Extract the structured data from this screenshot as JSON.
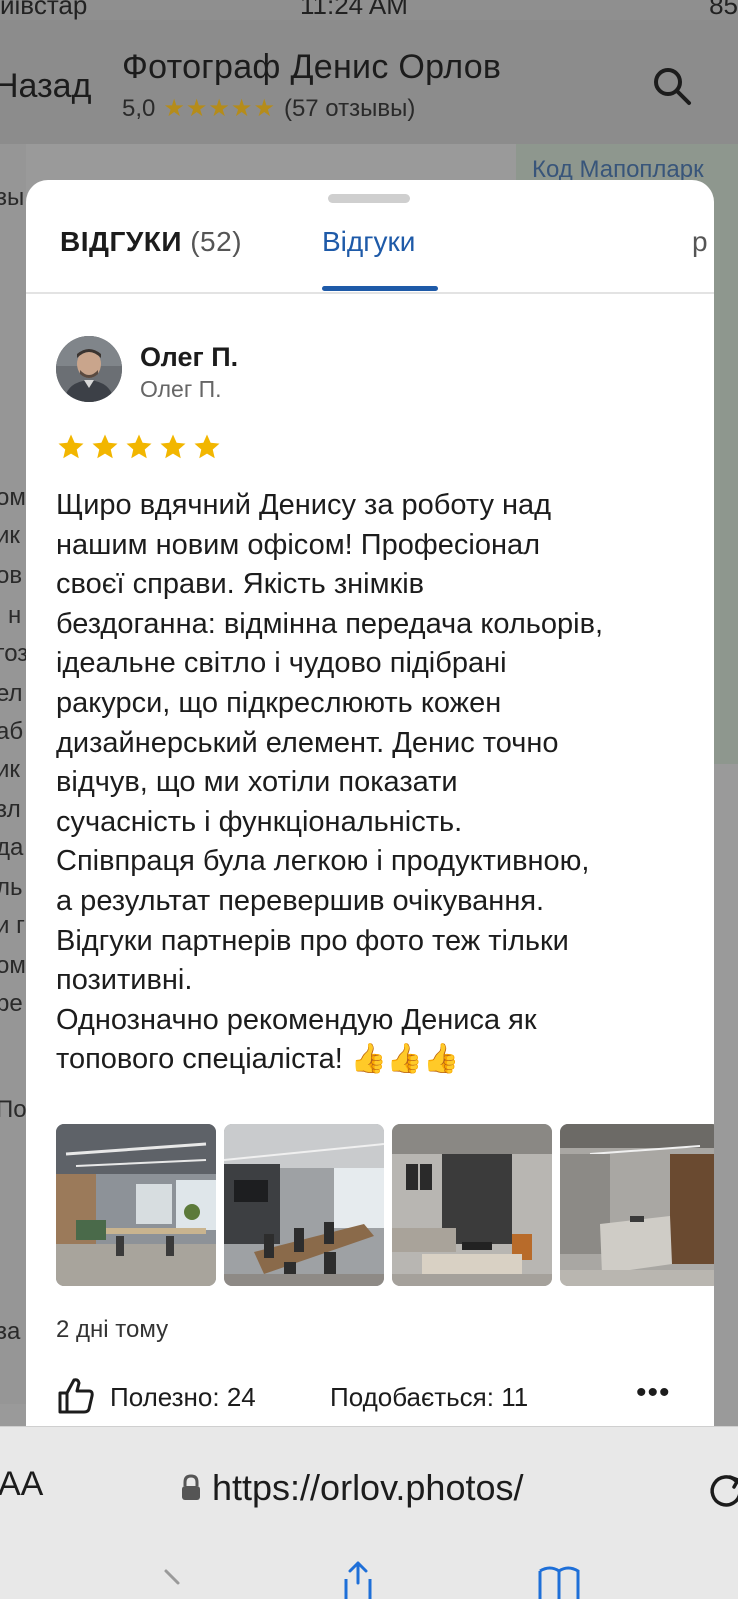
{
  "status_bar": {
    "carrier": "иівстар",
    "time": "11:24 AM",
    "battery": "85"
  },
  "header": {
    "back_label": "Назад",
    "title": "Фотограф Денис Орлов",
    "rating": "5,0",
    "stars": "★★★★★",
    "reviews_count_text": "(57 отзывы)"
  },
  "map": {
    "label": "Код Мапопларк"
  },
  "left_fragments": [
    "зы",
    "ом",
    "ик",
    "ов",
    "і н",
    "гоз",
    "ел",
    "аб",
    "ик",
    "зл",
    "да",
    "ль",
    "и г",
    "ом",
    "ре",
    "По",
    "за"
  ],
  "tabs": {
    "reviews_title": "ВІДГУКИ",
    "reviews_count": "(52)",
    "active_tab": "Відгуки",
    "cut_tab": "р"
  },
  "review": {
    "name": "Олег П.",
    "subname": "Олег П.",
    "rating": 5,
    "text": "Щиро вдячний Денису за роботу над\nнашим новим офісом! Професіонал\nсвоєї справи. Якість знімків\nбездоганна: відмінна передача кольорів,\nідеальне світло і чудово підібрані\nракурси, що підкреслюють кожен\nдизайнерський елемент. Денис точно\nвідчув, що ми хотіли показати\nсучасність і функціональність.\nСпівпраця була легкою і продуктивною,\nа результат перевершив очікування.\nВідгуки партнерів про фото теж тільки\nпозитивні.\nОднозначно рекомендую Дениса як\nтопового спеціаліста! 👍👍👍",
    "photos": [
      {
        "name": "office-openspace-photo"
      },
      {
        "name": "meeting-room-photo"
      },
      {
        "name": "lounge-room-photo"
      },
      {
        "name": "reception-photo"
      }
    ],
    "date": "2 дні тому",
    "helpful": "Полезно: 24",
    "likes": "Подобається: 11",
    "more": "•••"
  },
  "browser": {
    "aa_label": "AA",
    "url": "https://orlov.photos/"
  },
  "colors": {
    "accent": "#1e5aa8",
    "star": "#f2b600"
  }
}
